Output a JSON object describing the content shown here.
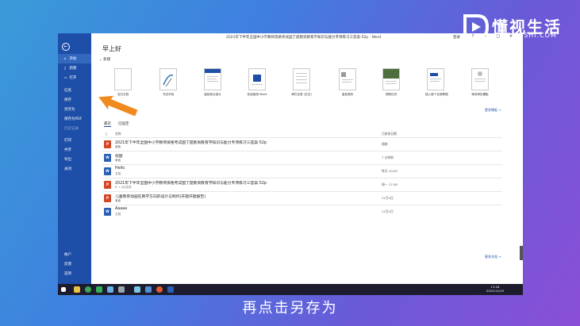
{
  "brand": {
    "title": "懂视生活",
    "subtitle": "SIDONGSHI.COM",
    "colors": {
      "sidebar": "#1e4fa8",
      "accent": "#f08a1e"
    }
  },
  "window": {
    "title": "2021年下半年全国中小学教师资格考试国丁提教资教育学知识与能力专项练习三答案-52p - Word",
    "user": "登录",
    "controls": [
      "?",
      "–",
      "□",
      "✕"
    ]
  },
  "sidebar": {
    "items": [
      {
        "label": "开始",
        "icon": "home-icon"
      },
      {
        "label": "新建",
        "icon": "new-doc-icon"
      },
      {
        "label": "打开",
        "icon": "folder-icon"
      },
      {
        "label": "信息"
      },
      {
        "label": "保存"
      },
      {
        "label": "另存为"
      },
      {
        "label": "保存为PDF"
      },
      {
        "label": "历史记录"
      },
      {
        "label": "打印"
      },
      {
        "label": "共享"
      },
      {
        "label": "导出"
      },
      {
        "label": "关闭"
      },
      {
        "label": "帐户"
      },
      {
        "label": "反馈"
      },
      {
        "label": "选项"
      }
    ]
  },
  "main": {
    "greeting": "早上好",
    "new_section_label": "新建",
    "templates": [
      {
        "label": "空白文档"
      },
      {
        "label": "书法字帖"
      },
      {
        "label": "蓝色商业信头"
      },
      {
        "label": "欢迎使用 Word"
      },
      {
        "label": "单栏目录 (空白)"
      },
      {
        "label": "蓝色简历"
      },
      {
        "label": "快照日历"
      },
      {
        "label": "插入首个目录教程"
      },
      {
        "label": "单页简历模板"
      }
    ],
    "more_templates": "更多模板 →",
    "tabs": [
      {
        "label": "最近"
      },
      {
        "label": "已固定"
      }
    ],
    "columns": {
      "name": "名称",
      "date": "已修改日期"
    },
    "recent": [
      {
        "name": "2021年下半年全国中小学教师资格考试国丁提教资教育学知识与能力专项练习三答案-52p",
        "location": "桌面",
        "date": "刚刚",
        "type": "pdf"
      },
      {
        "name": "标题",
        "location": "桌面",
        "date": "7 分钟前",
        "type": "word"
      },
      {
        "name": "Hello",
        "location": "文档",
        "date": "昨天 10:05",
        "type": "word"
      },
      {
        "name": "2021年下半年全国中小学教师资格考试国丁提教资教育学知识与能力专项练习三答案-52p",
        "location": "E: » QQ文件",
        "date": "周一 17:58",
        "type": "pdf"
      },
      {
        "name": "儿童教育动画在教学方向的设计与制作(开题开题报告)",
        "location": "桌面",
        "date": "11月3日",
        "type": "pdf"
      },
      {
        "name": "Aaaaa",
        "location": "文档",
        "date": "11月2日",
        "type": "word"
      }
    ],
    "more_docs": "更多文档 →"
  },
  "taskbar": {
    "time": "11:18",
    "date": "2021/11/19"
  },
  "caption": "再点击另存为"
}
